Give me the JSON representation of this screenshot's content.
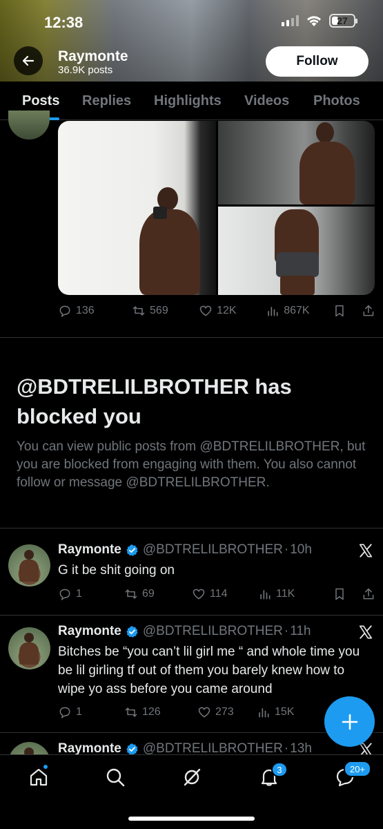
{
  "status_bar": {
    "time": "12:38",
    "battery": "27"
  },
  "header": {
    "name": "Raymonte",
    "post_count": "36.9K posts",
    "follow_label": "Follow"
  },
  "tabs": [
    {
      "label": "Posts",
      "active": true
    },
    {
      "label": "Replies",
      "active": false
    },
    {
      "label": "Highlights",
      "active": false
    },
    {
      "label": "Videos",
      "active": false
    },
    {
      "label": "Photos",
      "active": false
    }
  ],
  "photo_post": {
    "media": [
      "mirror-selfie-photo",
      "standing-photo",
      "mirror-selfie-photo-2"
    ],
    "stats": {
      "replies": "136",
      "reposts": "569",
      "likes": "12K",
      "views": "867K"
    }
  },
  "blocked": {
    "title": "@BDTRELILBROTHER has blocked you",
    "body": "You can view public posts from @BDTRELILBROTHER, but you are blocked from engaging with them. You also cannot follow or message @BDTRELILBROTHER."
  },
  "tweets": [
    {
      "name": "Raymonte",
      "handle": "@BDTRELILBROTHER",
      "time": "10h",
      "text": "G it be shit going on",
      "stats": {
        "replies": "1",
        "reposts": "69",
        "likes": "114",
        "views": "11K"
      }
    },
    {
      "name": "Raymonte",
      "handle": "@BDTRELILBROTHER",
      "time": "11h",
      "text": "Bitches be “you can’t lil girl me “ and whole time you be lil girling tf out of them you barely knew how to wipe yo ass before you came around",
      "stats": {
        "replies": "1",
        "reposts": "126",
        "likes": "273",
        "views": "15K"
      }
    },
    {
      "name": "Raymonte",
      "handle": "@BDTRELILBROTHER",
      "time": "13h"
    }
  ],
  "bottom_nav": {
    "items": [
      "home-icon",
      "search-icon",
      "grok-icon",
      "notifications-icon",
      "messages-icon"
    ],
    "notifications_badge": "3",
    "messages_badge": "20+"
  },
  "colors": {
    "accent": "#1d9bf0",
    "muted": "#71767b",
    "text": "#e7e9ea",
    "border": "#2f3336"
  }
}
